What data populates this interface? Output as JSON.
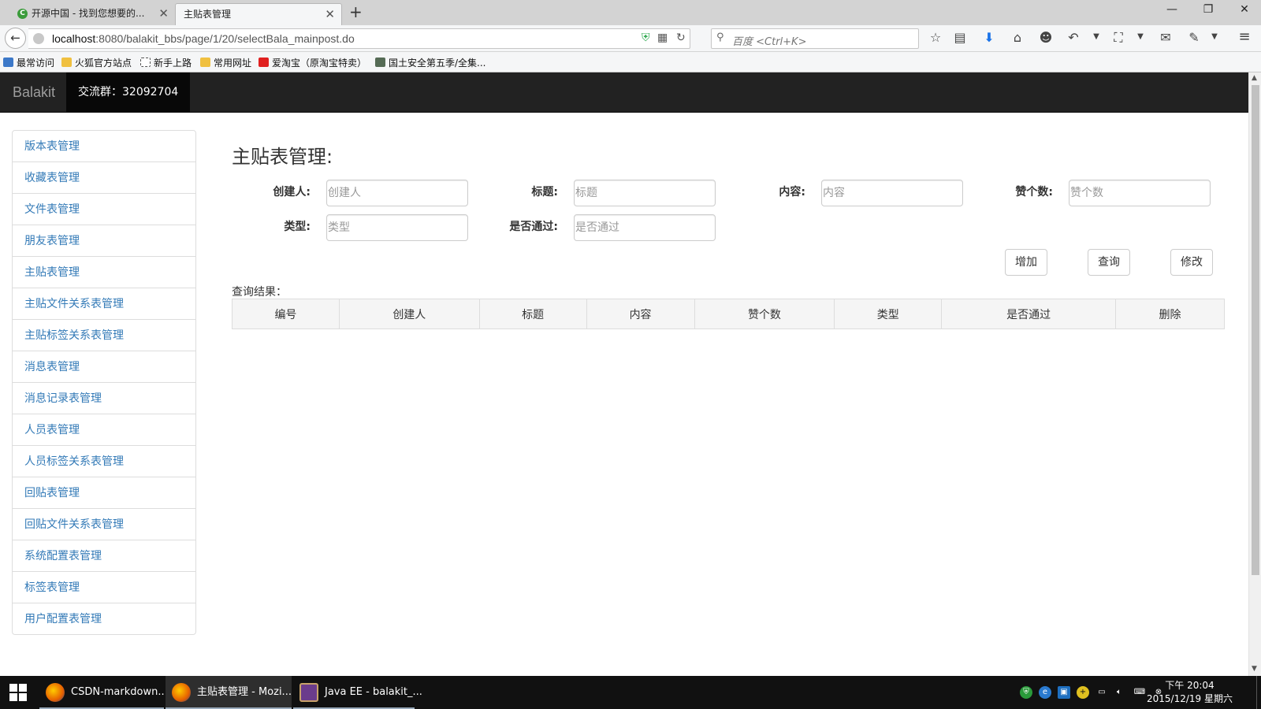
{
  "browser": {
    "tabs": [
      {
        "title": "开源中国 - 找到您想要的...",
        "active": false
      },
      {
        "title": "主贴表管理",
        "active": true
      }
    ],
    "url_host": "localhost",
    "url_rest": ":8080/balakit_bbs/page/1/20/selectBala_mainpost.do",
    "search_placeholder": "百度 <Ctrl+K>",
    "bookmarks": [
      {
        "label": "最常访问",
        "icon_color": "#3c78c8"
      },
      {
        "label": "火狐官方站点",
        "icon_color": "#f0c040"
      },
      {
        "label": "新手上路",
        "icon_color": "#ffffff"
      },
      {
        "label": "常用网址",
        "icon_color": "#f0c040"
      },
      {
        "label": "爱淘宝（原淘宝特卖）",
        "icon_color": "#e02020"
      },
      {
        "label": "国土安全第五季/全集...",
        "icon_color": "#556b55"
      }
    ]
  },
  "app": {
    "brand": "Balakit",
    "qq_group": "交流群：32092704"
  },
  "sidebar": {
    "items": [
      "版本表管理",
      "收藏表管理",
      "文件表管理",
      "朋友表管理",
      "主贴表管理",
      "主贴文件关系表管理",
      "主贴标签关系表管理",
      "消息表管理",
      "消息记录表管理",
      "人员表管理",
      "人员标签关系表管理",
      "回贴表管理",
      "回贴文件关系表管理",
      "系统配置表管理",
      "标签表管理",
      "用户配置表管理"
    ]
  },
  "main": {
    "title": "主贴表管理:",
    "fields": {
      "creator": {
        "label": "创建人:",
        "placeholder": "创建人",
        "value": ""
      },
      "title": {
        "label": "标题:",
        "placeholder": "标题",
        "value": ""
      },
      "content": {
        "label": "内容:",
        "placeholder": "内容",
        "value": ""
      },
      "likes": {
        "label": "赞个数:",
        "placeholder": "赞个数",
        "value": ""
      },
      "type": {
        "label": "类型:",
        "placeholder": "类型",
        "value": ""
      },
      "approved": {
        "label": "是否通过:",
        "placeholder": "是否通过",
        "value": ""
      }
    },
    "buttons": {
      "add": "增加",
      "query": "查询",
      "modify": "修改"
    },
    "result_label": "查询结果：",
    "table_headers": [
      "编号",
      "创建人",
      "标题",
      "内容",
      "赞个数",
      "类型",
      "是否通过",
      "删除"
    ]
  },
  "taskbar": {
    "tasks": [
      {
        "label": "CSDN-markdown...",
        "icon": "firefox-icon"
      },
      {
        "label": "主贴表管理 - Mozi...",
        "icon": "firefox-icon"
      },
      {
        "label": "Java EE - balakit_...",
        "icon": "eclipse-icon"
      }
    ],
    "clock_time": "下午 20:04",
    "clock_date": "2015/12/19 星期六"
  },
  "colors": {
    "navbar_bg": "#222222",
    "link": "#337ab7",
    "accent_blue": "#1a73e8"
  }
}
